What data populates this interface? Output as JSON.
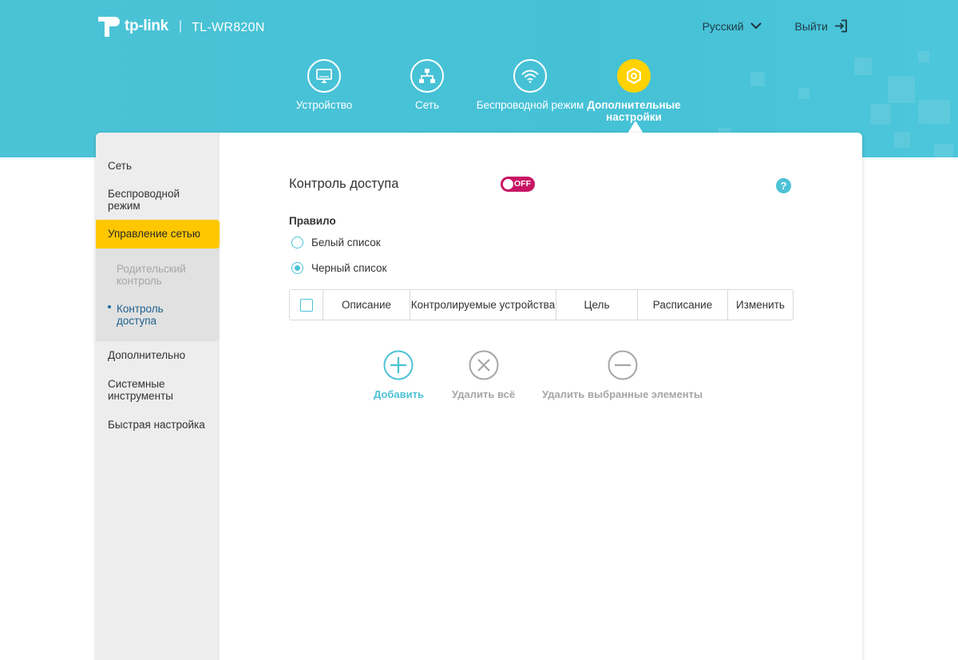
{
  "header": {
    "brand": "tp-link",
    "separator": "|",
    "model": "TL-WR820N",
    "language": "Русский",
    "logout": "Выйти"
  },
  "nav": {
    "tabs": [
      {
        "label": "Устройство",
        "icon": "monitor-icon"
      },
      {
        "label": "Сеть",
        "icon": "network-icon"
      },
      {
        "label": "Беспроводной режим",
        "icon": "wifi-icon"
      },
      {
        "label": "Дополнительные настройки",
        "icon": "gear-icon",
        "active": true
      }
    ]
  },
  "sidebar": {
    "items": [
      {
        "label": "Сеть"
      },
      {
        "label": "Беспроводной режим"
      },
      {
        "label": "Управление сетью",
        "active": true
      },
      {
        "label": "Дополнительно"
      },
      {
        "label": "Системные инструменты"
      },
      {
        "label": "Быстрая настройка"
      }
    ],
    "subitems": [
      {
        "label": "Родительский контроль"
      },
      {
        "label": "Контроль доступа",
        "active": true
      }
    ]
  },
  "main": {
    "title": "Контроль доступа",
    "toggle_label": "OFF",
    "help": "?",
    "rule_label": "Правило",
    "radios": [
      {
        "label": "Белый список",
        "checked": false
      },
      {
        "label": "Черный список",
        "checked": true
      }
    ],
    "table_headers": [
      "Описание",
      "Контролируемые устройства",
      "Цель",
      "Расписание",
      "Изменить"
    ],
    "actions": {
      "add": "Добавить",
      "delete_all": "Удалить всё",
      "delete_selected": "Удалить выбранные элементы"
    }
  },
  "colors": {
    "header_bg": "#4bc3d6",
    "accent_yellow": "#ffc700",
    "accent_teal": "#4cc2d6",
    "toggle_off": "#c81563",
    "disabled_gray": "#a6a6a6"
  }
}
